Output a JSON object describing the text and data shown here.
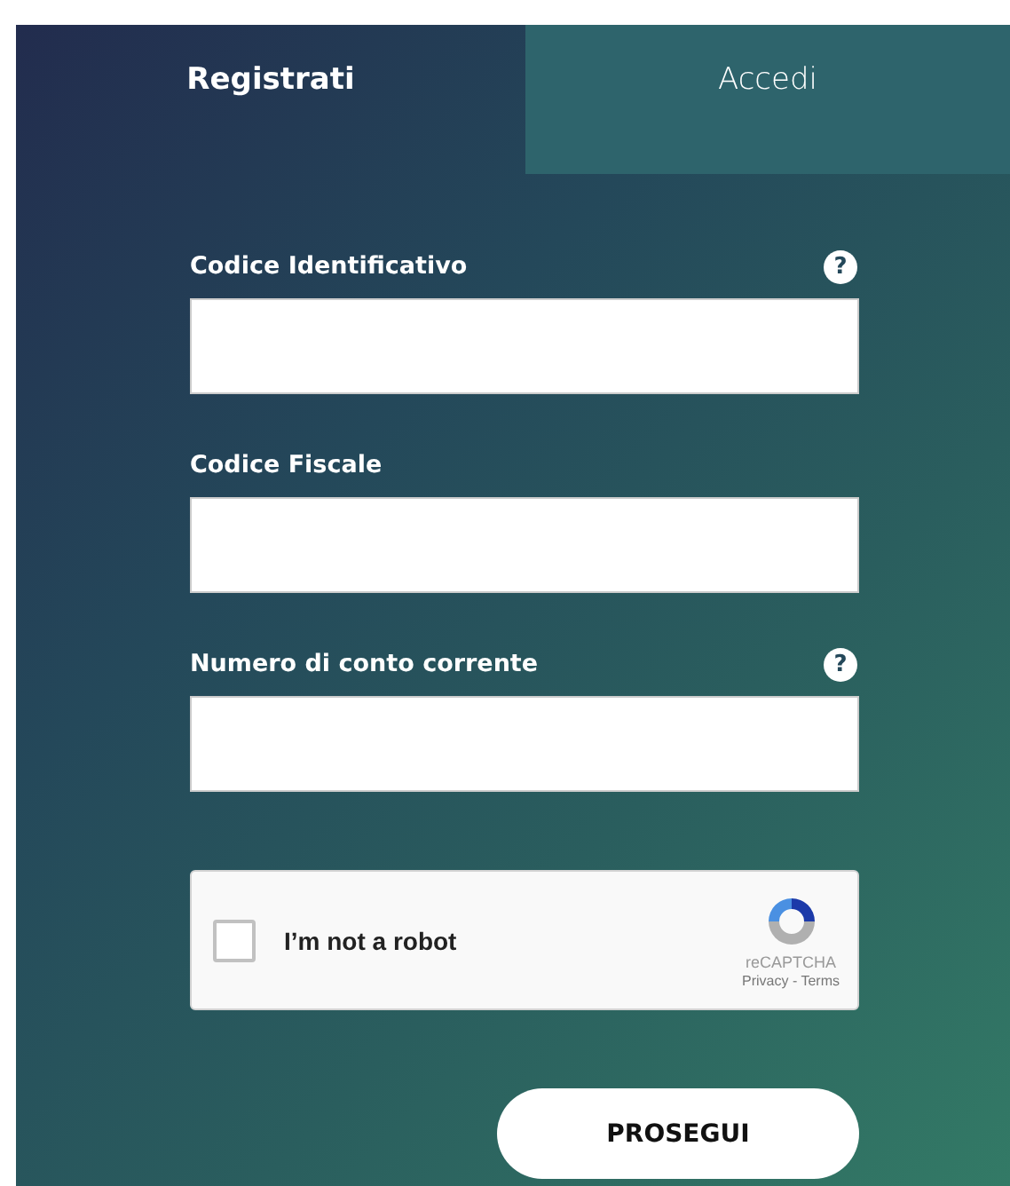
{
  "tabs": [
    {
      "label": "Registrati",
      "selected": true
    },
    {
      "label": "Accedi",
      "selected": false
    }
  ],
  "fields": [
    {
      "label": "Codice Identificativo",
      "help": "?"
    },
    {
      "label": "Codice Fiscale"
    },
    {
      "label": "Numero di conto corrente",
      "help": "?"
    }
  ],
  "captcha": {
    "label": "I’m not a robot",
    "checked": false,
    "brand": "reCAPTCHA",
    "links": "Privacy - Terms"
  },
  "submit": "PROSEGUI"
}
